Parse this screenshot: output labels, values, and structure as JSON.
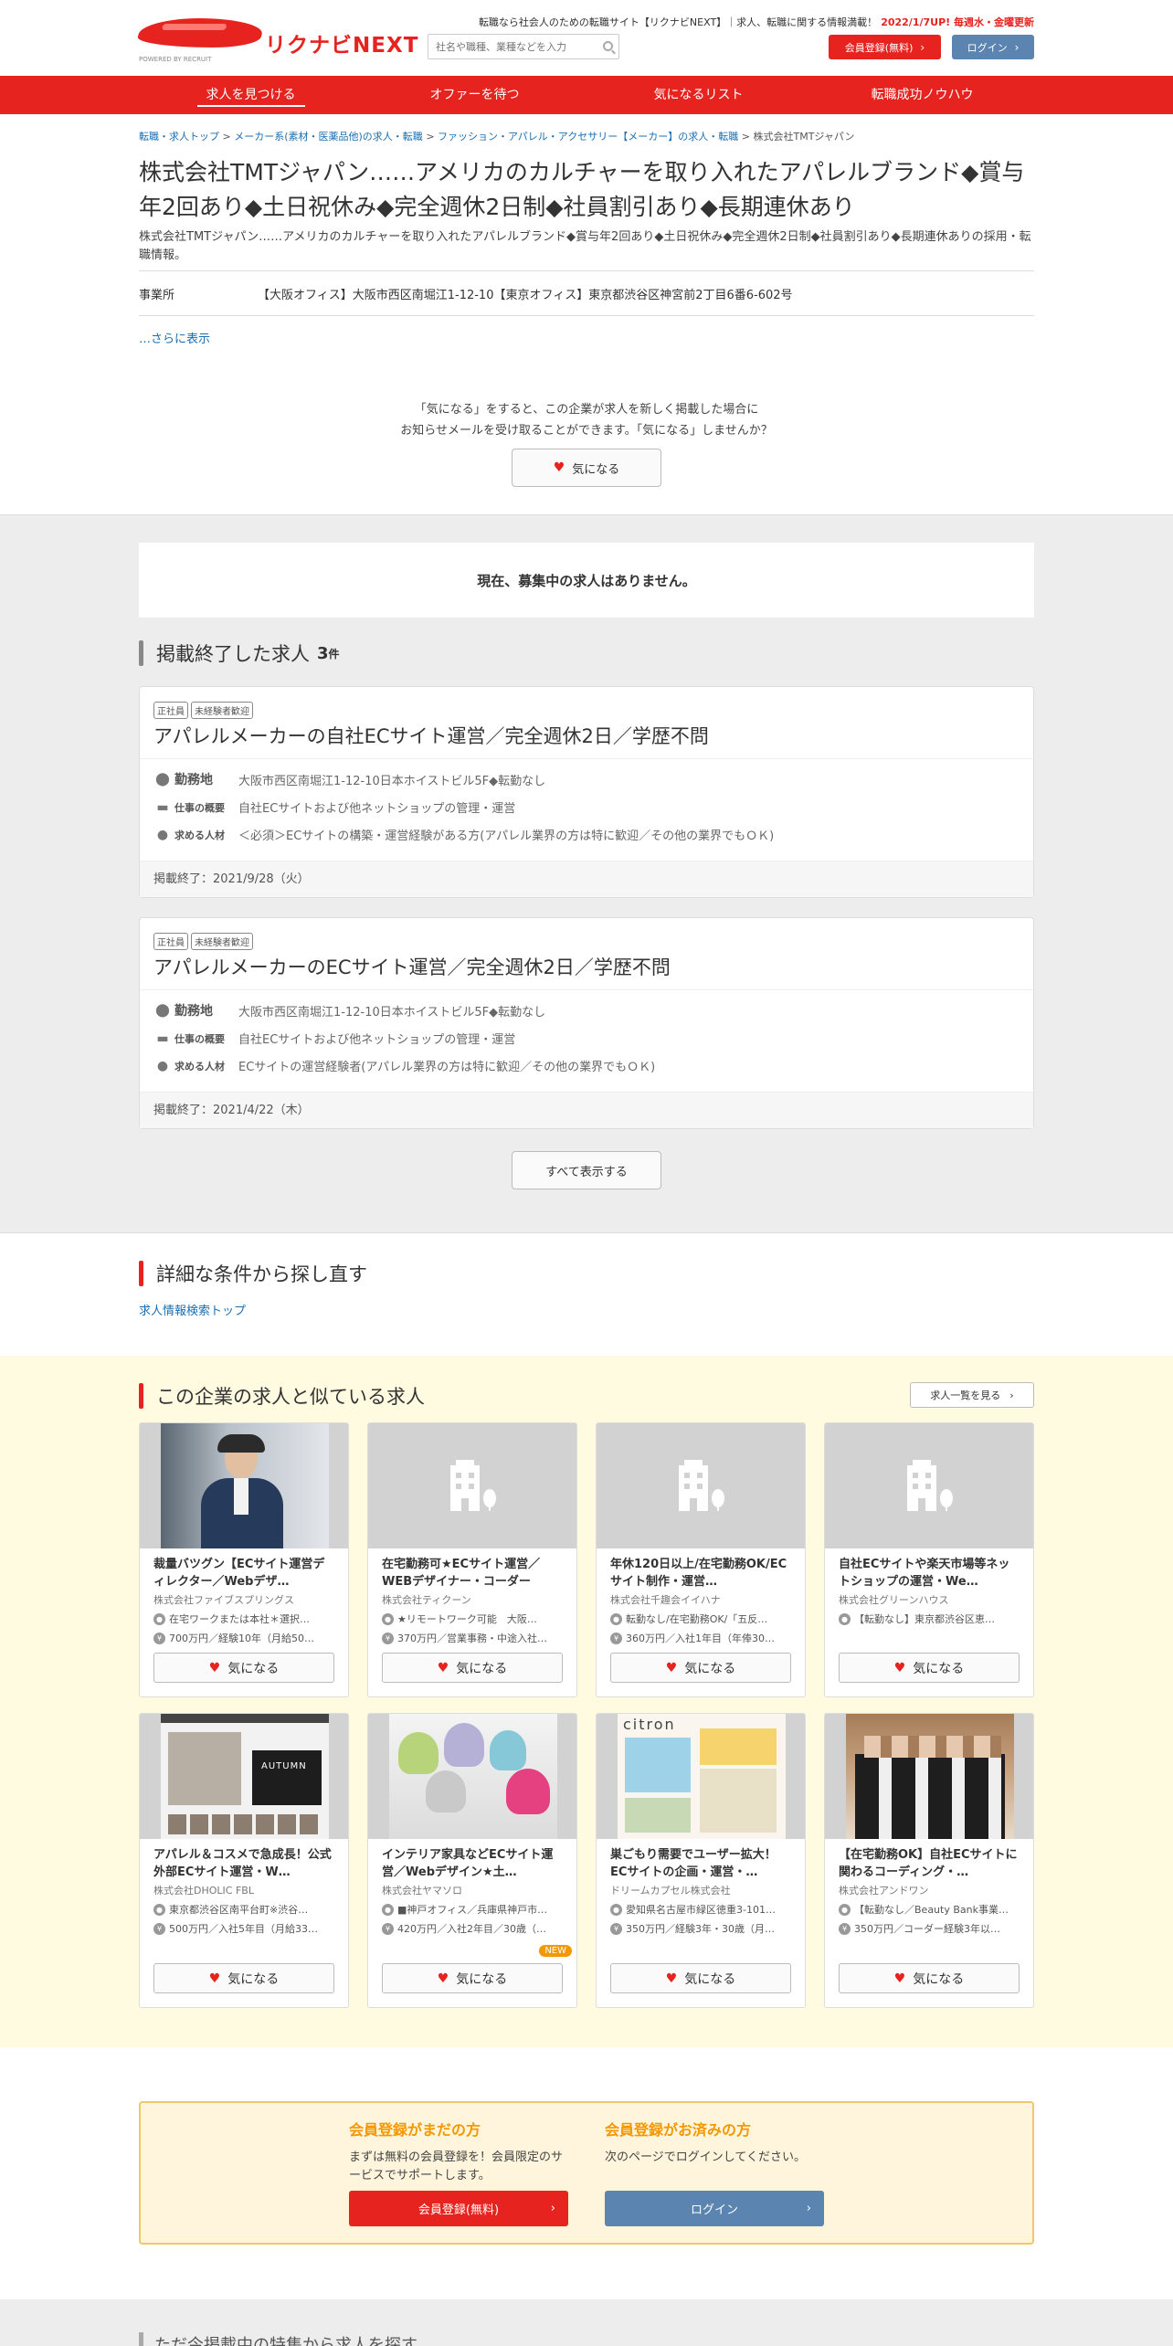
{
  "header": {
    "logo_text": "リクナビNEXT",
    "logo_sub": "POWERED BY RECRUIT",
    "tagline": "転職なら社会人のための転職サイト【リクナビNEXT】｜求人、転職に関する情報満載！",
    "update_info": "2022/1/7UP! 毎週水・金曜更新",
    "search_placeholder": "社名や職種、業種などを入力",
    "register_label": "会員登録(無料)",
    "login_label": "ログイン"
  },
  "nav": {
    "items": [
      "求人を見つける",
      "オファーを待つ",
      "気になるリスト",
      "転職成功ノウハウ"
    ]
  },
  "breadcrumb": {
    "items": [
      "転職・求人トップ",
      "メーカー系(素材・医薬品他)の求人・転職",
      "ファッション・アパレル・アクセサリー【メーカー】の求人・転職"
    ],
    "current": "株式会社TMTジャパン",
    "sep": ">"
  },
  "company": {
    "title": "株式会社TMTジャパン……アメリカのカルチャーを取り入れたアパレルブランド◆賞与年2回あり◆土日祝休み◆完全週休2日制◆社員割引あり◆長期連休あり",
    "description": "株式会社TMTジャパン……アメリカのカルチャーを取り入れたアパレルブランド◆賞与年2回あり◆土日祝休み◆完全週休2日制◆社員割引あり◆長期連休ありの採用・転職情報。",
    "office_label": "事業所",
    "office_value": "【大阪オフィス】大阪市西区南堀江1-12-10【東京オフィス】東京都渋谷区神宮前2丁目6番6-602号",
    "more_link": "…さらに表示"
  },
  "favorite_prompt": {
    "line1": "「気になる」をすると、この企業が求人を新しく掲載した場合に",
    "line2": "お知らせメールを受け取ることができます。「気になる」しませんか？",
    "button": "気になる"
  },
  "no_jobs": "現在、募集中の求人はありません。",
  "ended": {
    "heading": "掲載終了した求人",
    "count": "3",
    "unit": "件",
    "show_all": "すべて表示する",
    "jobs": [
      {
        "tags": [
          "正社員",
          "未経験者歓迎"
        ],
        "title": "アパレルメーカーの自社ECサイト運営／完全週休2日／学歴不問",
        "location_label": "勤務地",
        "location": "大阪市西区南堀江1-12-10日本ホイストビル5F◆転勤なし",
        "summary_label": "仕事の概要",
        "summary": "自社ECサイトおよび他ネットショップの管理・運営",
        "req_label": "求める人材",
        "req": "＜必須＞ECサイトの構築・運営経験がある方(アパレル業界の方は特に歓迎／その他の業界でもＯＫ)",
        "ended": "掲載終了：2021/9/28（火）"
      },
      {
        "tags": [
          "正社員",
          "未経験者歓迎"
        ],
        "title": "アパレルメーカーのECサイト運営／完全週休2日／学歴不問",
        "location_label": "勤務地",
        "location": "大阪市西区南堀江1-12-10日本ホイストビル5F◆転勤なし",
        "summary_label": "仕事の概要",
        "summary": "自社ECサイトおよび他ネットショップの管理・運営",
        "req_label": "求める人材",
        "req": "ECサイトの運営経験者(アパレル業界の方は特に歓迎／その他の業界でもＯＫ)",
        "ended": "掲載終了：2021/4/22（木）"
      }
    ]
  },
  "retry": {
    "heading": "詳細な条件から探し直す",
    "link": "求人情報検索トップ"
  },
  "similar": {
    "heading": "この企業の求人と似ている求人",
    "see_list": "求人一覧を見る",
    "fav_label": "気になる",
    "new_badge": "NEW",
    "cards": [
      {
        "title": "裁量バツグン【ECサイト運営ディレクター／Webデザ…",
        "company": "株式会社ファイブスプリングス",
        "loc": "在宅ワークまたは本社＊選択…",
        "pay": "700万円／経験10年（月給50…",
        "img": "man"
      },
      {
        "title": "在宅勤務可★ECサイト運営／WEBデザイナー・コーダー",
        "company": "株式会社ティクーン",
        "loc": "★リモートワーク可能　大阪…",
        "pay": "370万円／営業事務・中途入社…",
        "img": "none"
      },
      {
        "title": "年休120日以上/在宅勤務OK/ECサイト制作・運営…",
        "company": "株式会社千趣会イイハナ",
        "loc": "転勤なし/在宅勤務OK/「五反…",
        "pay": "360万円／入社1年目（年俸30…",
        "img": "none"
      },
      {
        "title": "自社ECサイトや楽天市場等ネットショップの運営・We…",
        "company": "株式会社グリーンハウス",
        "loc": "【転勤なし】東京都渋谷区恵…",
        "pay": "",
        "img": "none"
      },
      {
        "title": "アパレル＆コスメで急成長！公式外部ECサイト運営・W…",
        "company": "株式会社DHOLIC FBL",
        "loc": "東京都渋谷区南平台町※渋谷…",
        "pay": "500万円／入社5年目（月給33…",
        "img": "shop",
        "img_text": "AUTUMN"
      },
      {
        "title": "インテリア家具などECサイト運営／Webデザイン★土…",
        "company": "株式会社ヤマソロ",
        "loc": "■神戸オフィス／兵庫県神戸市…",
        "pay": "420万円／入社2年目／30歳（…",
        "img": "chairs",
        "is_new": true
      },
      {
        "title": "巣ごもり需要でユーザー拡大！ECサイトの企画・運営・…",
        "company": "ドリームカプセル株式会社",
        "loc": "愛知県名古屋市緑区徳重3-101…",
        "pay": "350万円／経験3年・30歳（月…",
        "img": "flyer",
        "img_text": "citron"
      },
      {
        "title": "【在宅勤務OK】自社ECサイトに関わるコーディング・…",
        "company": "株式会社アンドワン",
        "loc": "【転勤なし／Beauty Bank事業…",
        "pay": "350万円／コーダー経験3年以…",
        "img": "group"
      }
    ]
  },
  "register": {
    "left_heading": "会員登録がまだの方",
    "left_text": "まずは無料の会員登録を！会員限定のサービスでサポートします。",
    "left_button": "会員登録(無料)",
    "right_heading": "会員登録がお済みの方",
    "right_text": "次のページでログインしてください。",
    "right_button": "ログイン"
  },
  "bottom_heading": "ただ今掲載中の特集から求人を探す",
  "colors": {
    "brand_red": "#e6231f",
    "login_blue": "#5c84b1",
    "accent_orange": "#f39800"
  }
}
